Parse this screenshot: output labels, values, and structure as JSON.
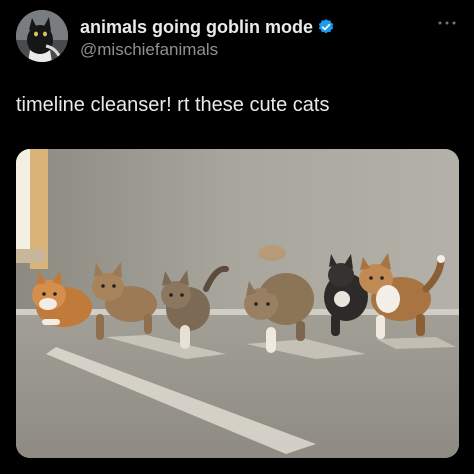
{
  "author": {
    "display_name": "animals going goblin mode",
    "handle": "@mischiefanimals",
    "verified": true,
    "avatar_icon": "black-cat-avatar"
  },
  "tweet": {
    "text": "timeline cleanser! rt these cute cats"
  },
  "media": {
    "icon": "photo-of-six-kittens-walking",
    "subject_count": 6
  },
  "colors": {
    "background": "#000000",
    "text_primary": "#e7e9ea",
    "text_secondary": "#8b9196",
    "verified_badge": "#1d9bf0"
  }
}
